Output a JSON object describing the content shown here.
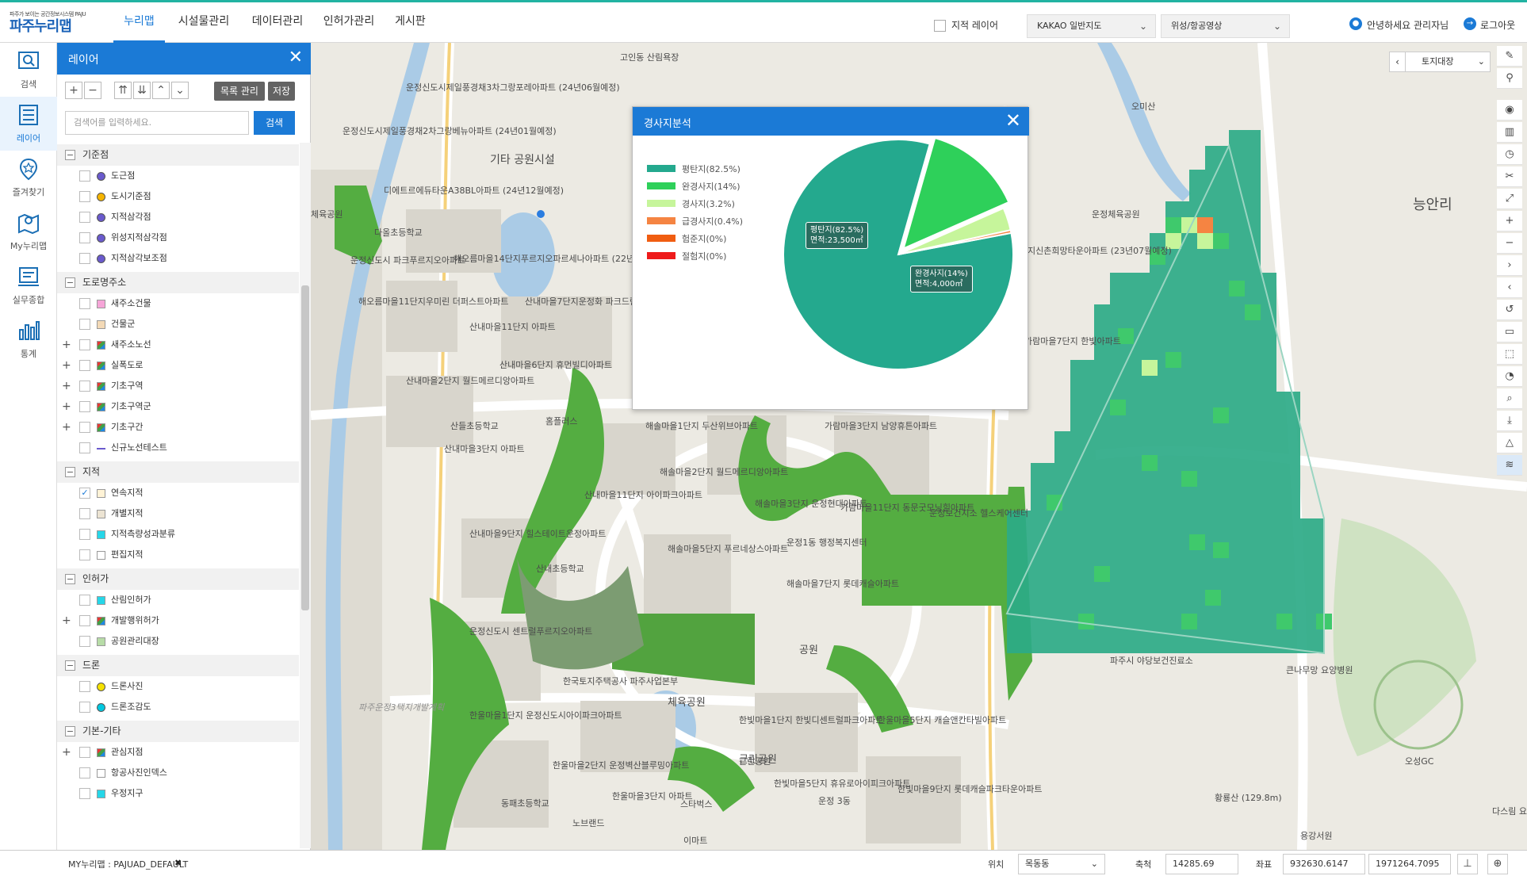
{
  "header": {
    "logo_sub": "파주가 보이는 공간정보시스템 PAJU",
    "logo_main": "파주누리맵",
    "menu": [
      "누리맵",
      "시설물관리",
      "데이터관리",
      "인허가관리",
      "게시판"
    ],
    "cadastral_label": "지적 레이어",
    "basemap_value": "KAKAO 일반지도",
    "imagery_value": "위성/항공영상",
    "user_text": "안녕하세요 관리자님",
    "logout_text": "로그아웃"
  },
  "leftnav": [
    {
      "label": "검색",
      "icon": "search-icon"
    },
    {
      "label": "레이어",
      "icon": "layers-icon"
    },
    {
      "label": "즐겨찾기",
      "icon": "bookmark-star-icon"
    },
    {
      "label": "My누리맵",
      "icon": "my-map-icon"
    },
    {
      "label": "실무종합",
      "icon": "work-summary-icon"
    },
    {
      "label": "통계",
      "icon": "bar-chart-icon"
    }
  ],
  "panel": {
    "title": "레이어",
    "list_manage_label": "목록 관리",
    "save_label": "저장",
    "search_placeholder": "검색어를 입력하세요.",
    "search_btn": "검색",
    "groups": [
      {
        "label": "기준점",
        "items": [
          {
            "label": "도근점",
            "color": "#6a5acd",
            "shape": "circle"
          },
          {
            "label": "도시기준점",
            "color": "#f5b400",
            "shape": "circle"
          },
          {
            "label": "지적삼각점",
            "color": "#6a5acd",
            "shape": "circle"
          },
          {
            "label": "위성지적삼각점",
            "color": "#6a5acd",
            "shape": "circle"
          },
          {
            "label": "지적삼각보조점",
            "color": "#6a5acd",
            "shape": "circle"
          }
        ]
      },
      {
        "label": "도로명주소",
        "items": [
          {
            "label": "새주소건물",
            "color": "#f6a5d8",
            "shape": "square"
          },
          {
            "label": "건물군",
            "color": "#f3d9b6",
            "shape": "square"
          },
          {
            "label": "새주소노선",
            "color": "multi",
            "shape": "square",
            "expand": true
          },
          {
            "label": "실폭도로",
            "color": "multi",
            "shape": "square",
            "expand": true
          },
          {
            "label": "기초구역",
            "color": "multi",
            "shape": "square",
            "expand": true
          },
          {
            "label": "기초구역군",
            "color": "multi",
            "shape": "square",
            "expand": true
          },
          {
            "label": "기초구간",
            "color": "multi",
            "shape": "square",
            "expand": true
          },
          {
            "label": "신규노선테스트",
            "color": "#6a5acd",
            "shape": "line"
          }
        ]
      },
      {
        "label": "지적",
        "items": [
          {
            "label": "연속지적",
            "color": "#fff3d6",
            "shape": "square",
            "checked": true
          },
          {
            "label": "개별지적",
            "color": "#ece4d3",
            "shape": "square"
          },
          {
            "label": "지적측량성과분류",
            "color": "#26d6e8",
            "shape": "square"
          },
          {
            "label": "편집지적",
            "color": "#ffffff",
            "shape": "square"
          }
        ]
      },
      {
        "label": "인허가",
        "items": [
          {
            "label": "산림인허가",
            "color": "#26d6e8",
            "shape": "square"
          },
          {
            "label": "개발행위허가",
            "color": "multi",
            "shape": "square",
            "expand": true
          },
          {
            "label": "공원관리대장",
            "color": "#b7dca7",
            "shape": "square"
          }
        ]
      },
      {
        "label": "드론",
        "items": [
          {
            "label": "드론사진",
            "color": "#f5e100",
            "shape": "circle"
          },
          {
            "label": "드론조감도",
            "color": "#00c8e0",
            "shape": "circle"
          }
        ]
      },
      {
        "label": "기본-기타",
        "items": [
          {
            "label": "관심지점",
            "color": "multi",
            "shape": "square",
            "expand": true
          },
          {
            "label": "항공사진인덱스",
            "color": "#ffffff",
            "shape": "square"
          },
          {
            "label": "우정지구",
            "color": "#26d6e8",
            "shape": "square"
          }
        ]
      }
    ]
  },
  "map": {
    "scale_select": "토지대장",
    "labels": [
      "고인동 산림욕장",
      "운정신도시제일풍경채3차그랑포레아파트 (24년06월예정)",
      "운정신도시제일풍경채2차그랑베뉴아파트 (24년01월예정)",
      "기타 공원시설",
      "디에트르에듀타운A38BL아파트 (24년12월예정)",
      "체육공원",
      "다올초등학교",
      "운정신도시 파크푸르지오아파트",
      "해오름마을14단지푸르지오파르세나아파트 (22년08월예정)",
      "해오름마을11단지우미린 더퍼스트아파트",
      "산내마을7단지운정화 파크드림시그니처아파",
      "산내마을11단지 아파트",
      "산내마을6단지 휴먼빌디아파트",
      "산내마을2단지 월드메르디앙아파트",
      "산들초등학교",
      "산내마을3단지 아파트",
      "홈플러스",
      "해솔마을1단지 두산위브아파트",
      "가람마을3단지 남양휴튼아파트",
      "산내마을11단지 아이파크아파트",
      "해솔마을2단지 월드메르디앙아파트",
      "해솔마을3단지 운정현대아파트",
      "가람마을11단지 동문굿모닝힐아파트",
      "운정보건지소 헬스케어센터",
      "운정1동 행정복지센터",
      "산내마을9단지 힐스테이트운정아파트",
      "해솔마을5단지 푸르네상스아파트",
      "해솔마을7단지 롯데캐슬아파트",
      "산내초등학교",
      "공원",
      "운정신도시 센트럴푸르지오아파트",
      "한국토지주택공사 파주사업본부",
      "한울마을1단지 운정신도시아이파크아파트",
      "체육공원",
      "한빛마을1단지 한빛디센트럴파크아파트",
      "한울마을5단지 캐슬앤칸타빌아파트",
      "한울마을2단지 운정벽산블루밍아파트",
      "근린공원",
      "한빛마을5단지 휴유로아이피크아파트",
      "한울마을3단지 아파트",
      "스타벅스",
      "한빛마을9단지 롯데캐슬파크타운아파트",
      "동패초등학교",
      "노브랜드",
      "이마트",
      "오미산",
      "능안리",
      "운정체육공원",
      "지신촌희망타운아파트 (23년07월예정)",
      "가람마을7단지 한빛아파트",
      "파주시 야당보건진료소",
      "큰나무망 요양병원",
      "오성GC",
      "황룡산 (129.8m)",
      "용강서원",
      "다스림 요양병원",
      "근린공원",
      "운정 3동",
      "파주운정3택지개발계획"
    ]
  },
  "slope_popup": {
    "title": "경사지분석",
    "legend": [
      "평탄지(82.5%)",
      "완경사지(14%)",
      "경사지(3.2%)",
      "급경사지(0.4%)",
      "험준지(0%)",
      "절험지(0%)"
    ],
    "callout1_line1": "평탄지(82.5%)",
    "callout1_line2": "면적:23,500㎡",
    "callout2_line1": "완경사지(14%)",
    "callout2_line2": "면적:4,000㎡"
  },
  "chart_data": {
    "type": "pie",
    "title": "경사지분석",
    "categories": [
      "평탄지",
      "완경사지",
      "경사지",
      "급경사지",
      "험준지",
      "절험지"
    ],
    "values": [
      82.5,
      14,
      3.2,
      0.4,
      0,
      0
    ],
    "colors": [
      "#24a98e",
      "#2ed05a",
      "#c6f59b",
      "#f58442",
      "#f05d11",
      "#ee1b1b"
    ],
    "annotations": [
      {
        "category": "평탄지",
        "area": "23,500㎡"
      },
      {
        "category": "완경사지",
        "area": "4,000㎡"
      }
    ]
  },
  "map_tools": [
    "brush-icon",
    "pin-icon",
    "marker-icon",
    "columns-icon",
    "clock-icon",
    "scissors-icon",
    "expand-icon",
    "zoom-in-icon",
    "zoom-out-icon",
    "next-icon",
    "prev-icon",
    "refresh-icon",
    "ruler-icon",
    "select-area-icon",
    "area-icon",
    "magnify-icon",
    "download-icon",
    "mountain-icon",
    "slope-analysis-icon"
  ],
  "statusbar": {
    "my_map": "MY누리맵 : PAJUAD_DEFAULT",
    "loc_label": "위치",
    "loc_value": "목동동",
    "scale_label": "축척",
    "scale_value": "14285.69",
    "coord_label": "좌표",
    "coord_x": "932630.6147",
    "coord_y": "1971264.7095"
  }
}
